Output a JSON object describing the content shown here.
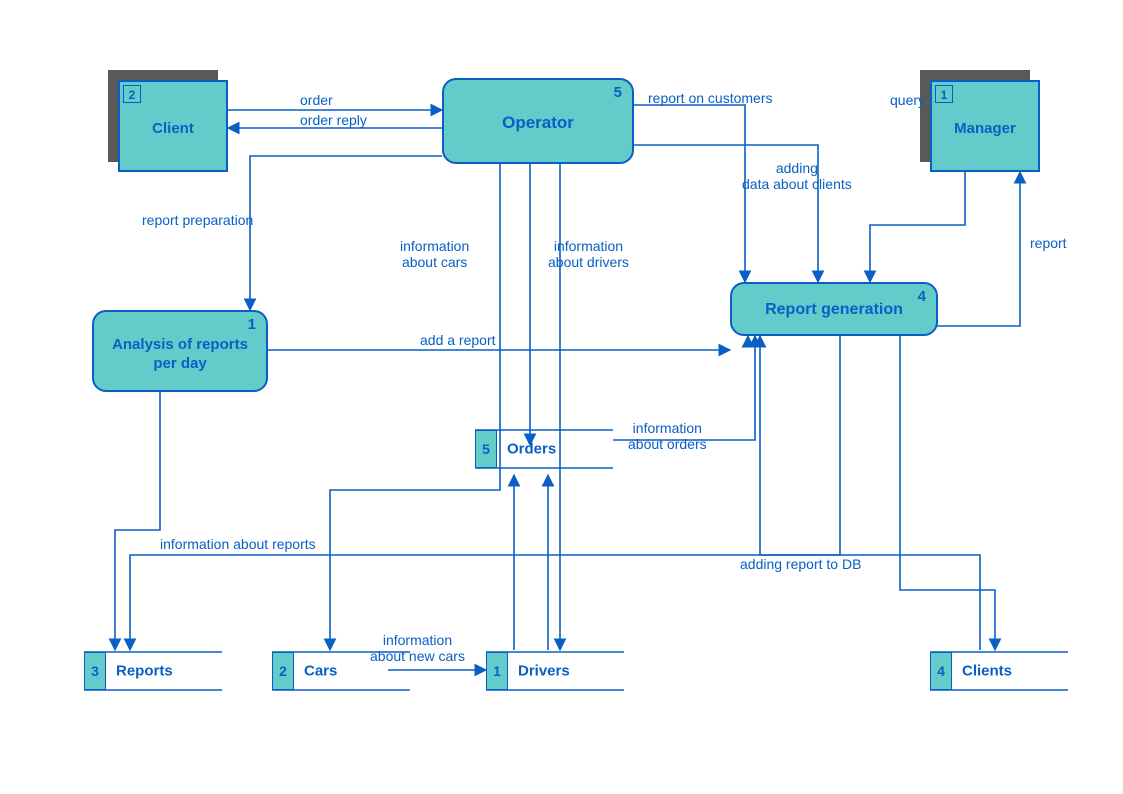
{
  "diagram_type": "Data Flow Diagram (Gane & Sarson)",
  "processes": {
    "operator": {
      "num": "5",
      "label": "Operator"
    },
    "reportgen": {
      "num": "4",
      "label": "Report generation"
    },
    "analysis": {
      "num": "1",
      "label": "Analysis of reports\nper day"
    }
  },
  "externals": {
    "client": {
      "num": "2",
      "label": "Client"
    },
    "manager": {
      "num": "1",
      "label": "Manager"
    }
  },
  "datastores": {
    "orders": {
      "num": "5",
      "label": "Orders"
    },
    "reports": {
      "num": "3",
      "label": "Reports"
    },
    "cars": {
      "num": "2",
      "label": "Cars"
    },
    "drivers": {
      "num": "1",
      "label": "Drivers"
    },
    "clients": {
      "num": "4",
      "label": "Clients"
    }
  },
  "edges": {
    "order": "order",
    "order_reply": "order reply",
    "report_on_customers": "report on customers",
    "adding_clients": "adding\ndata about clients",
    "query": "query",
    "report": "report",
    "report_prep": "report preparation",
    "info_cars": "information\nabout cars",
    "info_drivers": "information\nabout drivers",
    "add_a_report": "add a report",
    "info_orders": "information\nabout orders",
    "info_reports": "information about reports",
    "adding_report_db": "adding report to DB",
    "info_new_cars": "information\nabout new cars"
  },
  "colors": {
    "node_fill": "#63cbca",
    "stroke": "#0a5fc4",
    "shadow": "#595959"
  }
}
